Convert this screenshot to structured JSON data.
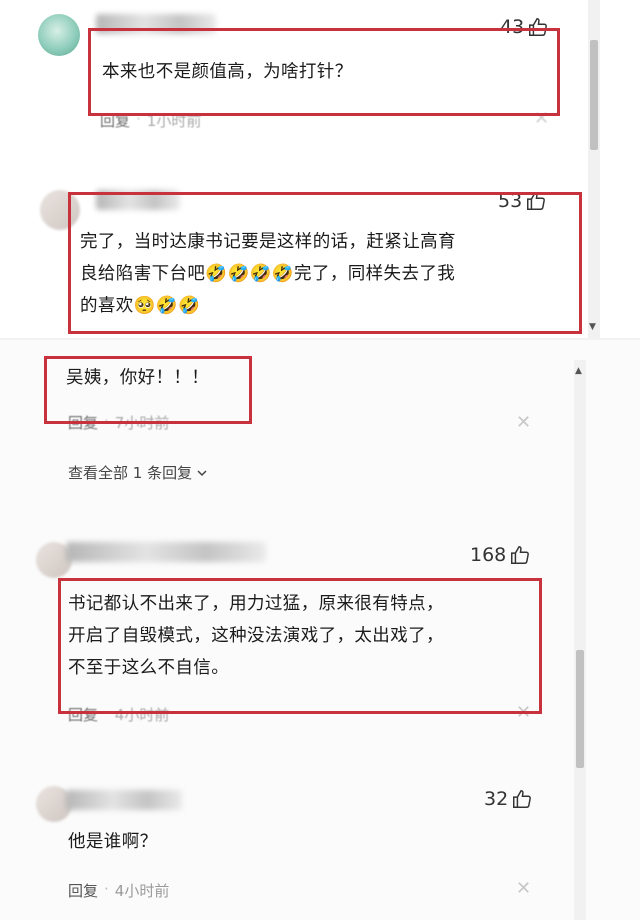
{
  "comments": [
    {
      "likes": "43",
      "text": "本来也不是颜值高，为啥打针？",
      "reply": "回复",
      "time": "1小时前"
    },
    {
      "likes": "53",
      "text": "完了，当时达康书记要是这样的话，赶紧让高育良给陷害下台吧🤣🤣🤣🤣完了，同样失去了我的喜欢🥺🤣🤣",
      "line1": "完了，当时达康书记要是这样的话，赶紧让高育",
      "line2": "良给陷害下台吧🤣🤣🤣🤣完了，同样失去了我",
      "line3": "的喜欢🥺🤣🤣"
    },
    {
      "text": "吴姨，你好！！！",
      "reply": "回复",
      "time": "7小时前",
      "view_all": "查看全部 1 条回复"
    },
    {
      "likes": "168",
      "line1": "书记都认不出来了，用力过猛，原来很有特点，",
      "line2": "开启了自毁模式，这种没法演戏了，太出戏了，",
      "line3": "不至于这么不自信。",
      "reply": "回复",
      "time": "4小时前"
    },
    {
      "likes": "32",
      "text": "他是谁啊？",
      "reply": "回复",
      "time": "4小时前"
    }
  ],
  "icons": {
    "like": "thumbs-up-icon",
    "close": "close-icon",
    "expand": "chevron-down-icon"
  },
  "colors": {
    "highlight_box": "#c8323c",
    "meta_time": "#9b9b9b"
  }
}
